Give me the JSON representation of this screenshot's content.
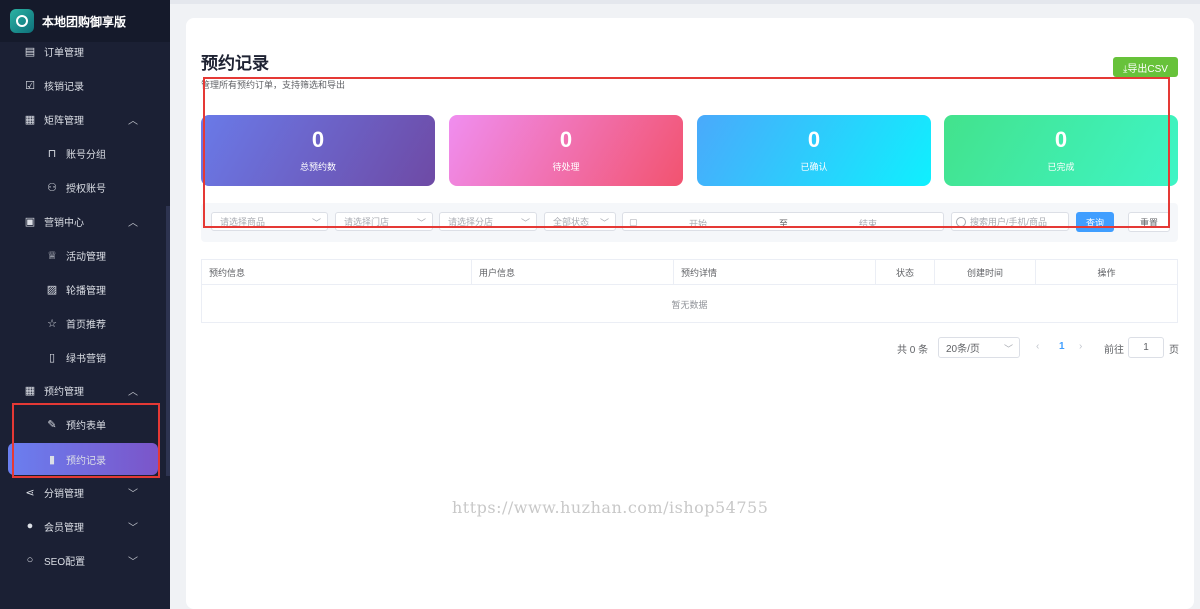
{
  "app": {
    "title": "本地团购御享版"
  },
  "sidebar": {
    "items": [
      {
        "label": "订单管理",
        "icon": "document-icon"
      },
      {
        "label": "核销记录",
        "icon": "clipboard-check-icon"
      },
      {
        "label": "矩阵管理",
        "icon": "grid-icon",
        "expanded": true
      },
      {
        "label": "账号分组",
        "icon": "bookmark-icon"
      },
      {
        "label": "授权账号",
        "icon": "user-icon"
      },
      {
        "label": "营销中心",
        "icon": "gift-icon",
        "expanded": true
      },
      {
        "label": "活动管理",
        "icon": "trophy-icon"
      },
      {
        "label": "轮播管理",
        "icon": "image-icon"
      },
      {
        "label": "首页推荐",
        "icon": "star-icon"
      },
      {
        "label": "绿书营销",
        "icon": "book-icon"
      },
      {
        "label": "预约管理",
        "icon": "calendar-icon",
        "expanded": true
      },
      {
        "label": "预约表单",
        "icon": "edit-icon"
      },
      {
        "label": "预约记录",
        "icon": "clipboard-icon",
        "active": true
      },
      {
        "label": "分销管理",
        "icon": "share-icon",
        "expanded": false
      },
      {
        "label": "会员管理",
        "icon": "user-solid-icon",
        "expanded": false
      },
      {
        "label": "SEO配置",
        "icon": "search-icon",
        "expanded": false
      }
    ]
  },
  "page": {
    "title": "预约记录",
    "description": "管理所有预约订单，支持筛选和导出",
    "export_label": "⤓导出CSV"
  },
  "stats": [
    {
      "value": "0",
      "label": "总预约数"
    },
    {
      "value": "0",
      "label": "待处理"
    },
    {
      "value": "0",
      "label": "已确认"
    },
    {
      "value": "0",
      "label": "已完成"
    }
  ],
  "filters": {
    "product_placeholder": "请选择商品",
    "store_placeholder": "请选择门店",
    "branch_placeholder": "请选择分店",
    "status_value": "全部状态",
    "date_start": "开始",
    "date_sep": "至",
    "date_end": "结束",
    "search_placeholder": "搜索用户/手机/商品",
    "query_label": "查询",
    "reset_label": "重置"
  },
  "table": {
    "columns": [
      "预约信息",
      "用户信息",
      "预约详情",
      "状态",
      "创建时间",
      "操作"
    ],
    "empty_text": "暂无数据"
  },
  "pagination": {
    "total_text": "共 0 条",
    "page_size": "20条/页",
    "current_page": "1",
    "goto_label": "前往",
    "goto_value": "1",
    "page_unit": "页"
  },
  "watermark": "https://www.huzhan.com/ishop54755",
  "colors": {
    "sidebar_bg": "#1b2034",
    "primary": "#409eff",
    "export": "#67c23a",
    "highlight": "#e53935"
  }
}
